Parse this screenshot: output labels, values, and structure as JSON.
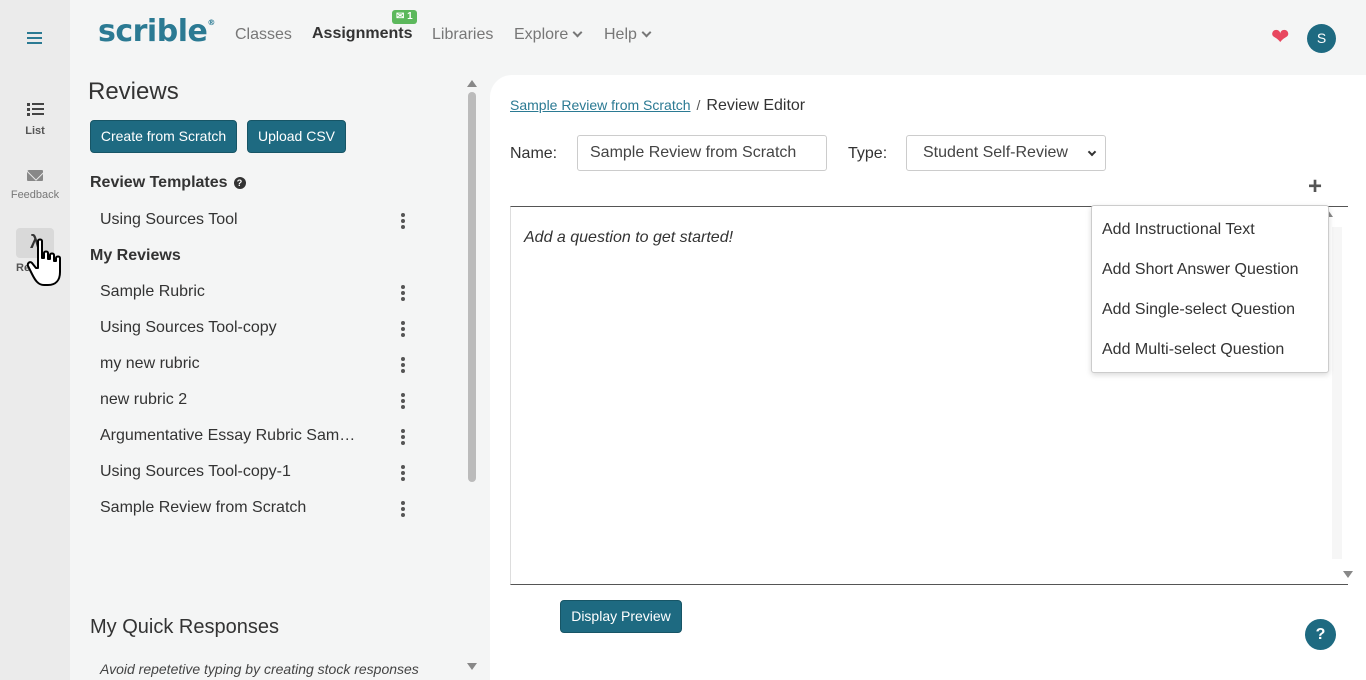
{
  "nav": {
    "logo": "scrible",
    "logo_mark": "®",
    "links": [
      "Classes",
      "Assignments",
      "Libraries",
      "Explore",
      "Help"
    ],
    "assignments_badge": "1",
    "avatar_initial": "S",
    "heart_icon": "heart-icon",
    "badge_icon": "envelope-icon"
  },
  "rail": {
    "list_label": "List",
    "feedback_label": "Feedback",
    "reviews_label_partial": "Re",
    "reviews_icon_glyph": "λ"
  },
  "left": {
    "title": "Reviews",
    "create_button": "Create from Scratch",
    "upload_button": "Upload CSV",
    "templates_heading": "Review Templates",
    "templates": [
      "Using Sources Tool"
    ],
    "my_reviews_heading": "My Reviews",
    "my_reviews": [
      "Sample Rubric",
      "Using Sources Tool-copy",
      "my new rubric",
      "new rubric 2",
      "Argumentative Essay Rubric Sample",
      "Using Sources Tool-copy-1",
      "Sample Review from Scratch"
    ],
    "quick_title": "My Quick Responses",
    "quick_sub": "Avoid repetetive typing by creating stock responses"
  },
  "main": {
    "breadcrumb_link": "Sample Review from Scratch",
    "breadcrumb_sep": "/",
    "breadcrumb_current": "Review Editor",
    "name_label": "Name:",
    "name_value": "Sample Review from Scratch",
    "type_label": "Type:",
    "type_value": "Student Self-Review",
    "editor_placeholder": "Add a question to get started!",
    "add_menu": [
      "Add Instructional Text",
      "Add Short Answer Question",
      "Add Single-select Question",
      "Add Multi-select Question"
    ],
    "preview_button": "Display Preview",
    "help_glyph": "?"
  },
  "colors": {
    "brand": "#2b7a93",
    "button": "#1e6a81",
    "badge": "#5cb85c",
    "heart": "#e8475f"
  }
}
